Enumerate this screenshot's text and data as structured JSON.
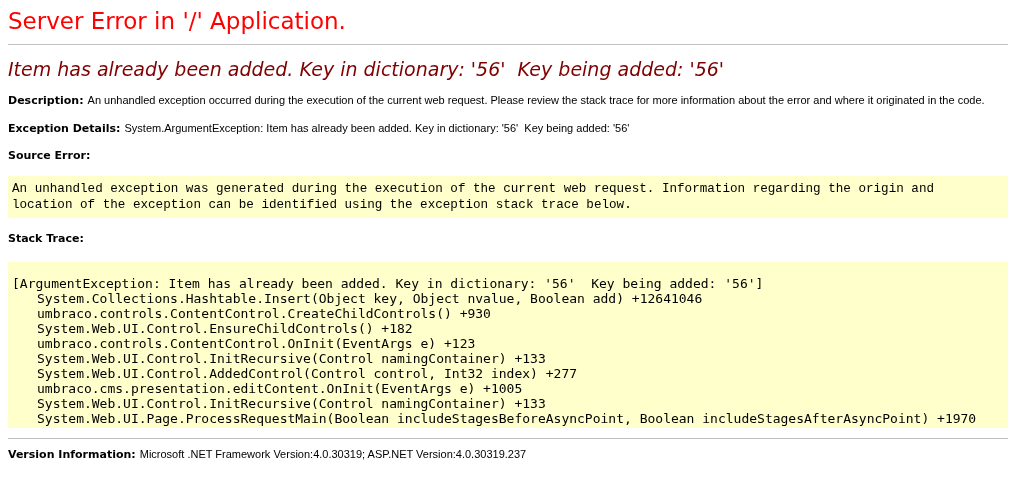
{
  "title": "Server Error in '/' Application.",
  "error_heading": "Item has already been added. Key in dictionary: '56'  Key being added: '56'",
  "description": {
    "label": "Description:",
    "text": "An unhandled exception occurred during the execution of the current web request. Please review the stack trace for more information about the error and where it originated in the code."
  },
  "exception_details": {
    "label": "Exception Details:",
    "text": "System.ArgumentException: Item has already been added. Key in dictionary: '56'  Key being added: '56'"
  },
  "source_error": {
    "label": "Source Error:",
    "lines": [
      "An unhandled exception was generated during the execution of the current web request. Information regarding the origin and",
      "location of the exception can be identified using the exception stack trace below."
    ]
  },
  "stack_trace": {
    "label": "Stack Trace:",
    "header": "[ArgumentException: Item has already been added. Key in dictionary: '56'  Key being added: '56']",
    "frames": [
      "System.Collections.Hashtable.Insert(Object key, Object nvalue, Boolean add) +12641046",
      "umbraco.controls.ContentControl.CreateChildControls() +930",
      "System.Web.UI.Control.EnsureChildControls() +182",
      "umbraco.controls.ContentControl.OnInit(EventArgs e) +123",
      "System.Web.UI.Control.InitRecursive(Control namingContainer) +133",
      "System.Web.UI.Control.AddedControl(Control control, Int32 index) +277",
      "umbraco.cms.presentation.editContent.OnInit(EventArgs e) +1005",
      "System.Web.UI.Control.InitRecursive(Control namingContainer) +133",
      "System.Web.UI.Page.ProcessRequestMain(Boolean includeStagesBeforeAsyncPoint, Boolean includeStagesAfterAsyncPoint) +1970"
    ]
  },
  "version": {
    "label": "Version Information:",
    "text": "Microsoft .NET Framework Version:4.0.30319; ASP.NET Version:4.0.30319.237"
  }
}
